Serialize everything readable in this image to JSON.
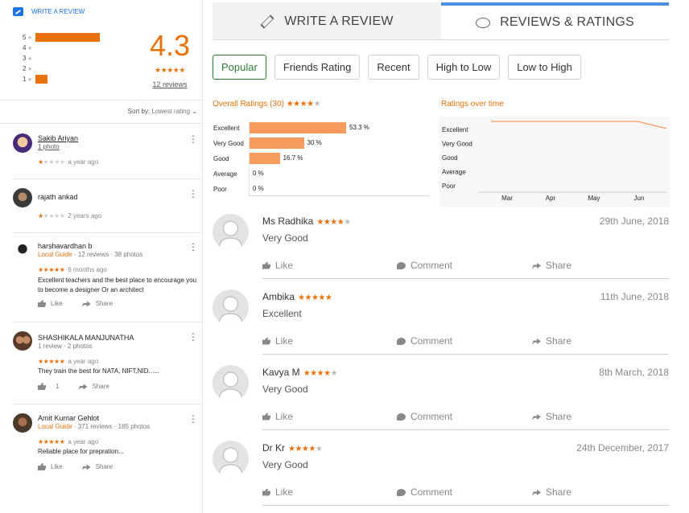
{
  "left": {
    "write_review": "WRITE A REVIEW",
    "histogram": [
      {
        "star": "5",
        "fraction": 0.53
      },
      {
        "star": "4",
        "fraction": 0
      },
      {
        "star": "3",
        "fraction": 0
      },
      {
        "star": "2",
        "fraction": 0
      },
      {
        "star": "1",
        "fraction": 0.1
      }
    ],
    "score": "4.3",
    "score_stars": "★★★★★",
    "reviews_count": "12 reviews",
    "sort_label": "Sort by:",
    "sort_value": "Lowest rating",
    "reviews": [
      {
        "name": "Sakib Ariyan",
        "sub": "1 photo",
        "stars_filled": "★",
        "stars_empty": "★★★★",
        "time": "a year ago"
      },
      {
        "name": "rajath ankad",
        "stars_filled": "★",
        "stars_empty": "★★★★",
        "time": "2 years ago"
      },
      {
        "name": "harshavardhan b",
        "guide": "Local Guide",
        "sub": "· 12 reviews · 38 photos",
        "stars_filled": "★★★★★",
        "stars_empty": "",
        "time": "6 months ago",
        "text": "Excellent teachers and the best place to encourage you to become a designer Or an architect",
        "like": "Like",
        "share": "Share"
      },
      {
        "name": "SHASHIKALA MANJUNATHA",
        "sub": "1 review · 2 photos",
        "stars_filled": "★★★★★",
        "stars_empty": "",
        "time": "a year ago",
        "text": "They train the best for NATA, NIFT,NID......",
        "like": "1",
        "share": "Share"
      },
      {
        "name": "Amit Kumar Gehlot",
        "guide": "Local Guide",
        "sub": "· 371 reviews · 185 photos",
        "stars_filled": "★★★★★",
        "stars_empty": "",
        "time": "a year ago",
        "text": "Reliable place for prepration...",
        "like": "Like",
        "share": "Share"
      }
    ]
  },
  "tabs": {
    "write": "WRITE A REVIEW",
    "reviews": "REVIEWS & RATINGS"
  },
  "filters": [
    "Popular",
    "Friends Rating",
    "Recent",
    "High to Low",
    "Low to High"
  ],
  "overall": {
    "title": "Overall Ratings (30)",
    "stars_filled": "★★★★",
    "stars_empty": "★"
  },
  "over_time": {
    "title": "Ratings over time"
  },
  "chart_data": [
    {
      "type": "bar",
      "title": "Overall Ratings (30)",
      "categories": [
        "Excellent",
        "Very Good",
        "Good",
        "Average",
        "Poor"
      ],
      "values": [
        53.3,
        30,
        16.7,
        0,
        0
      ],
      "labels": [
        "53.3 %",
        "30 %",
        "16.7 %",
        "0 %",
        "0 %"
      ],
      "orientation": "horizontal",
      "color": "#f79a5e"
    },
    {
      "type": "line",
      "title": "Ratings over time",
      "x": [
        "Mar",
        "Apr",
        "May",
        "Jun"
      ],
      "ylabels": [
        "Excellent",
        "Very Good",
        "Good",
        "Average",
        "Poor"
      ],
      "series": [
        {
          "values": [
            4,
            4,
            4,
            4,
            3.5
          ]
        }
      ],
      "color": "#f79a5e"
    }
  ],
  "reviews": [
    {
      "name": "Ms Radhika",
      "stars_filled": "★★★★",
      "stars_empty": "★",
      "date": "29th June, 2018",
      "text": "Very Good",
      "like": "Like",
      "comment": "Comment",
      "share": "Share"
    },
    {
      "name": "Ambika",
      "stars_filled": "★★★★★",
      "stars_empty": "",
      "date": "11th June, 2018",
      "text": "Excellent",
      "like": "Like",
      "comment": "Comment",
      "share": "Share"
    },
    {
      "name": "Kavya M",
      "stars_filled": "★★★★",
      "stars_empty": "★",
      "date": "8th March, 2018",
      "text": "Very Good",
      "like": "Like",
      "comment": "Comment",
      "share": "Share"
    },
    {
      "name": "Dr Kr",
      "stars_filled": "★★★★",
      "stars_empty": "★",
      "date": "24th December, 2017",
      "text": "Very Good",
      "like": "Like",
      "comment": "Comment",
      "share": "Share"
    }
  ],
  "colors": {
    "accent": "#e8710a",
    "tab_border": "#4a90e2",
    "active_filter": "#2e7d32",
    "bar": "#f79a5e"
  }
}
